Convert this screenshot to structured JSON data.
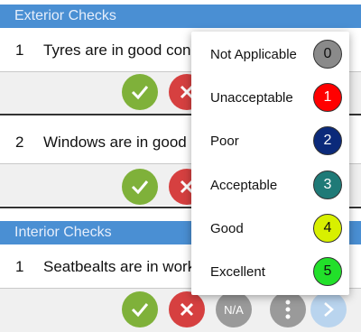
{
  "sections": [
    {
      "title": "Exterior Checks",
      "items": [
        {
          "number": "1",
          "text": "Tyres are in good condition"
        },
        {
          "number": "2",
          "text": "Windows are in good condition"
        }
      ]
    },
    {
      "title": "Interior Checks",
      "items": [
        {
          "number": "1",
          "text": "Seatbealts are in working order"
        }
      ]
    }
  ],
  "buttons": {
    "na_label": "N/A"
  },
  "rating_menu": {
    "options": [
      {
        "label": "Not Applicable",
        "value": "0",
        "color": "#8a8a8a",
        "text_color": "#111111"
      },
      {
        "label": "Unacceptable",
        "value": "1",
        "color": "#ff0000",
        "text_color": "#ffffff"
      },
      {
        "label": "Poor",
        "value": "2",
        "color": "#0b2a7a",
        "text_color": "#ffffff"
      },
      {
        "label": "Acceptable",
        "value": "3",
        "color": "#1f7a77",
        "text_color": "#ffffff"
      },
      {
        "label": "Good",
        "value": "4",
        "color": "#d8f000",
        "text_color": "#111111"
      },
      {
        "label": "Excellent",
        "value": "5",
        "color": "#22e02a",
        "text_color": "#111111"
      }
    ]
  },
  "colors": {
    "header_bg": "#4a8fd3",
    "accept": "#7fb13a",
    "reject": "#d64040",
    "neutral": "#9a9a9a",
    "next": "#b9d4ee"
  }
}
